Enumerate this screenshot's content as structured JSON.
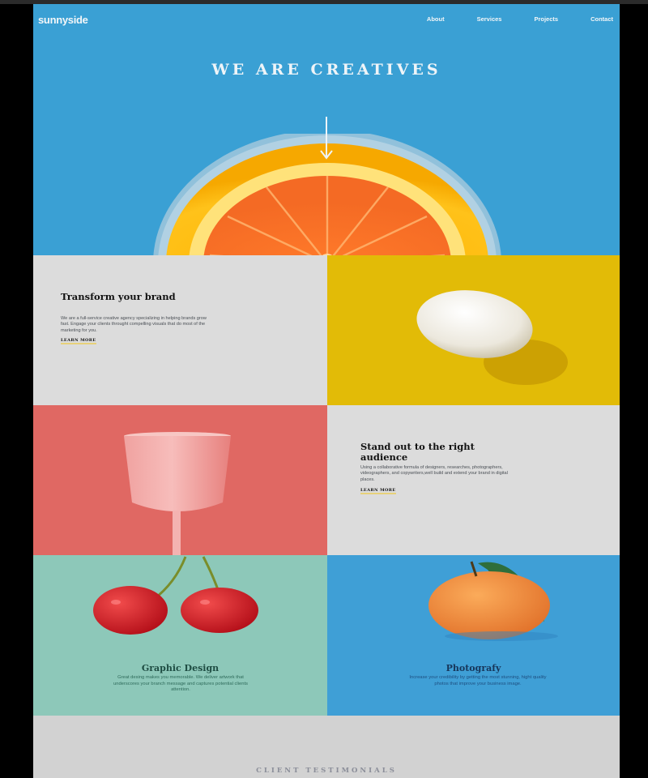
{
  "brand": {
    "logo": "sunnyside"
  },
  "nav": {
    "items": [
      "About",
      "Services",
      "Projects",
      "Contact"
    ]
  },
  "hero": {
    "title": "WE ARE CREATIVES"
  },
  "features": [
    {
      "heading": "Transform your brand",
      "body": "We are a full-service creative agency specializing in helping brands grow fast. Engage your clients throught compelling visuals that do most of the marketing for you.",
      "link": "LEARN MORE"
    },
    {
      "heading": "Stand out to the right audience",
      "body": "Using a collaborative formula of designers, researches, photographers, videographers, and copywriters,well build and extend your brand in digital places.",
      "link": "LEARN MORE"
    }
  ],
  "services": [
    {
      "title": "Graphic Design",
      "body": "Great desing makes you memorable. We deliver artwork that underscores your branch message and captures potential clients attention."
    },
    {
      "title": "Photografy",
      "body": "Increase your credibility by getting the most stunning, hight quality photos that improve your business image."
    }
  ],
  "testimonials": {
    "title": "CLIENT TESTIMONIALS"
  },
  "colors": {
    "hero_blue": "#3aa0d4",
    "egg_yellow": "#e2bb07",
    "glass_red": "#e06863",
    "cherry_mint": "#8dc8b9",
    "orange_blue": "#3f9fd6",
    "graphic_design_text": "#1f4d43",
    "photography_text": "#17365a"
  }
}
